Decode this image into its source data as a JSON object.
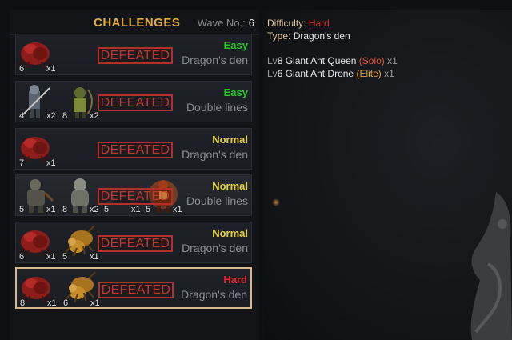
{
  "header": {
    "title": "CHALLENGES",
    "wave_label": "Wave No.:",
    "wave_number": "6"
  },
  "rows": [
    {
      "difficulty": "Easy",
      "difficulty_color": "#22cc22",
      "type": "Dragon's den",
      "status": "DEFEATED",
      "monsters": [
        {
          "icon": "red-beetle-icon",
          "level": "6",
          "count": "1"
        }
      ]
    },
    {
      "difficulty": "Easy",
      "difficulty_color": "#22cc22",
      "type": "Double lines",
      "status": "DEFEATED",
      "monsters": [
        {
          "icon": "armored-knight-icon",
          "level": "4",
          "count": "2"
        },
        {
          "icon": "goblin-archer-icon",
          "level": "8",
          "count": "2"
        }
      ]
    },
    {
      "difficulty": "Normal",
      "difficulty_color": "#e8d23a",
      "type": "Dragon's den",
      "status": "DEFEATED",
      "monsters": [
        {
          "icon": "red-beetle-icon",
          "level": "7",
          "count": "1"
        }
      ]
    },
    {
      "difficulty": "Normal",
      "difficulty_color": "#e8d23a",
      "type": "Double lines",
      "status": "DEFEATED",
      "monsters": [
        {
          "icon": "ogre-icon",
          "level": "5",
          "count": "1"
        },
        {
          "icon": "troll-icon",
          "level": "8",
          "count": "2"
        },
        {
          "icon": "shadow-spider-icon",
          "level": "5",
          "count": "1"
        },
        {
          "icon": "fire-demon-icon",
          "level": "5",
          "count": "1"
        }
      ]
    },
    {
      "difficulty": "Normal",
      "difficulty_color": "#e8d23a",
      "type": "Dragon's den",
      "status": "DEFEATED",
      "monsters": [
        {
          "icon": "red-beetle-icon",
          "level": "6",
          "count": "1"
        },
        {
          "icon": "giant-ant-icon",
          "level": "5",
          "count": "1"
        }
      ]
    },
    {
      "difficulty": "Hard",
      "difficulty_color": "#e02a2a",
      "type": "Dragon's den",
      "status": "DEFEATED",
      "selected": true,
      "monsters": [
        {
          "icon": "red-beetle-icon",
          "level": "8",
          "count": "1"
        },
        {
          "icon": "giant-ant-icon",
          "level": "6",
          "count": "1"
        }
      ]
    }
  ],
  "details": {
    "difficulty_label": "Difficulty:",
    "difficulty_value": "Hard",
    "type_label": "Type:",
    "type_value": "Dragon's den",
    "enemies": [
      {
        "lv_prefix": "Lv",
        "level": "8",
        "name": "Giant Ant Queen",
        "tag": "(Solo)",
        "tag_color": "#e05040",
        "count": "x1"
      },
      {
        "lv_prefix": "Lv",
        "level": "6",
        "name": "Giant Ant Drone",
        "tag": "(Elite)",
        "tag_color": "#e8a040",
        "count": "x1"
      }
    ]
  }
}
